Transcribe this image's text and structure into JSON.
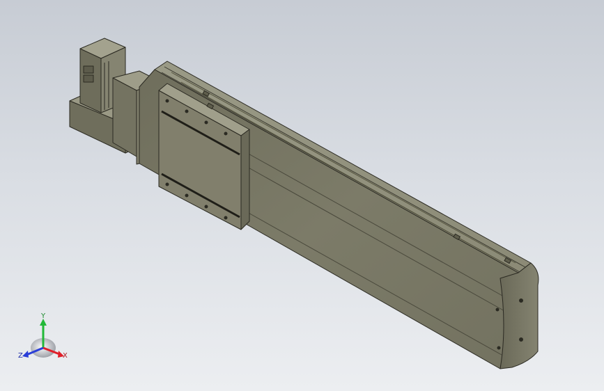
{
  "viewport": {
    "background_top": "#c7ccd4",
    "background_bottom": "#eceef1"
  },
  "model": {
    "description_icon": "linear-actuator-model",
    "body_color": "#7f7e6c",
    "edge_color": "#2b2a22"
  },
  "triad": {
    "x_label": "X",
    "y_label": "Y",
    "z_label": "Z",
    "x_color": "#e0202a",
    "y_color": "#22b838",
    "z_color": "#2a3ed8"
  }
}
